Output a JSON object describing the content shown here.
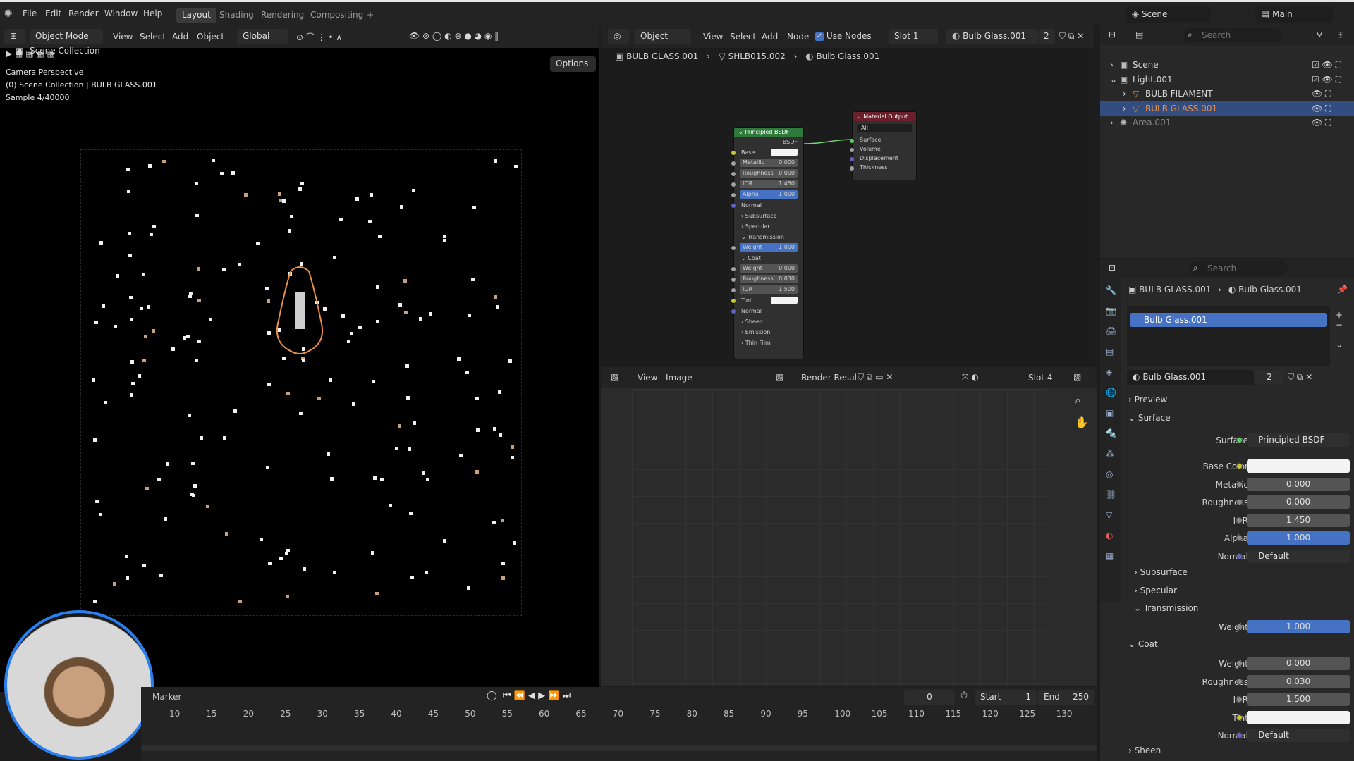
{
  "topbar": {
    "menus": [
      "File",
      "Edit",
      "Render",
      "Window",
      "Help"
    ],
    "workspace_tabs": [
      "Layout",
      "Shading",
      "Rendering",
      "Compositing"
    ],
    "active_tab": "Layout",
    "plus": "+",
    "scene_label": "Scene",
    "view_layer_label": "Main"
  },
  "viewport_header": {
    "mode": "Object Mode",
    "menus": [
      "View",
      "Select",
      "Add",
      "Object"
    ],
    "transform": "Global",
    "options": "Options"
  },
  "viewport_overlay": {
    "line1": "Camera Perspective",
    "line2": "(0) Scene Collection | BULB GLASS.001",
    "line3": "Sample 4/40000"
  },
  "node_header": {
    "object_type": "Object",
    "menus": [
      "View",
      "Select",
      "Add",
      "Node"
    ],
    "use_nodes": "Use Nodes",
    "slot": "Slot 1",
    "material": "Bulb Glass.001",
    "users": "2",
    "breadcrumb": [
      "BULB GLASS.001",
      "SHLB015.002",
      "Bulb Glass.001"
    ]
  },
  "principled_node": {
    "title": "Principled BSDF",
    "output": "BSDF",
    "rows": [
      {
        "label": "Base ...",
        "value": "",
        "kind": "white"
      },
      {
        "label": "Metallic",
        "value": "0.000",
        "kind": "field"
      },
      {
        "label": "Roughness",
        "value": "0.000",
        "kind": "field"
      },
      {
        "label": "IOR",
        "value": "1.450",
        "kind": "field"
      },
      {
        "label": "Alpha",
        "value": "1.000",
        "kind": "blue"
      },
      {
        "label": "Normal",
        "value": "",
        "kind": "label"
      },
      {
        "label": "Subsurface",
        "value": "",
        "kind": "section"
      },
      {
        "label": "Specular",
        "value": "",
        "kind": "section"
      },
      {
        "label": "Transmission",
        "value": "",
        "kind": "section-open"
      },
      {
        "label": "Weight",
        "value": "1.000",
        "kind": "blue"
      },
      {
        "label": "Coat",
        "value": "",
        "kind": "section-open"
      },
      {
        "label": "Weight",
        "value": "0.000",
        "kind": "field"
      },
      {
        "label": "Roughness",
        "value": "0.030",
        "kind": "field"
      },
      {
        "label": "IOR",
        "value": "1.500",
        "kind": "field"
      },
      {
        "label": "Tint",
        "value": "",
        "kind": "white"
      },
      {
        "label": "Normal",
        "value": "",
        "kind": "label"
      },
      {
        "label": "Sheen",
        "value": "",
        "kind": "section"
      },
      {
        "label": "Emission",
        "value": "",
        "kind": "section"
      },
      {
        "label": "Thin Film",
        "value": "",
        "kind": "section"
      }
    ]
  },
  "output_node": {
    "title": "Material Output",
    "target": "All",
    "sockets": [
      "Surface",
      "Volume",
      "Displacement",
      "Thickness"
    ]
  },
  "image_editor": {
    "menus": [
      "View",
      "Image"
    ],
    "image": "Render Result",
    "slot": "Slot 4"
  },
  "timeline": {
    "marker": "Marker",
    "current_frame": "0",
    "start_label": "Start",
    "start": "1",
    "end_label": "End",
    "end": "250",
    "ticks": [
      "10",
      "15",
      "20",
      "25",
      "30",
      "35",
      "40",
      "45",
      "50",
      "55",
      "60",
      "65",
      "70",
      "75",
      "80",
      "85",
      "90",
      "95",
      "100",
      "105",
      "110",
      "115",
      "120",
      "125",
      "130"
    ]
  },
  "outliner": {
    "search_placeholder": "Search",
    "root": "Scene Collection",
    "items": [
      {
        "label": "Scene",
        "indent": 1
      },
      {
        "label": "Light.001",
        "indent": 1
      },
      {
        "label": "BULB FILAMENT",
        "indent": 2
      },
      {
        "label": "BULB GLASS.001",
        "indent": 2
      },
      {
        "label": "Area.001",
        "indent": 1
      }
    ]
  },
  "properties": {
    "search_placeholder": "Search",
    "breadcrumb_object": "BULB GLASS.001",
    "breadcrumb_material": "Bulb Glass.001",
    "slot_item": "Bulb Glass.001",
    "material_name": "Bulb Glass.001",
    "material_users": "2",
    "preview": "Preview",
    "surface_section": "Surface",
    "surface_label": "Surface",
    "surface_value": "Principled BSDF",
    "rows": [
      {
        "label": "Base Color",
        "value": "",
        "kind": "white"
      },
      {
        "label": "Metallic",
        "value": "0.000",
        "kind": "field"
      },
      {
        "label": "Roughness",
        "value": "0.000",
        "kind": "field"
      },
      {
        "label": "IOR",
        "value": "1.450",
        "kind": "field"
      },
      {
        "label": "Alpha",
        "value": "1.000",
        "kind": "blue"
      },
      {
        "label": "Normal",
        "value": "Default",
        "kind": "dark"
      }
    ],
    "subsections": [
      "Subsurface",
      "Specular",
      "Transmission"
    ],
    "transmission_weight_label": "Weight",
    "transmission_weight": "1.000",
    "coat_section": "Coat",
    "coat_rows": [
      {
        "label": "Weight",
        "value": "0.000",
        "kind": "field"
      },
      {
        "label": "Roughness",
        "value": "0.030",
        "kind": "field"
      },
      {
        "label": "IOR",
        "value": "1.500",
        "kind": "field"
      },
      {
        "label": "Tint",
        "value": "",
        "kind": "white"
      },
      {
        "label": "Normal",
        "value": "Default",
        "kind": "dark"
      }
    ],
    "sheen": "Sheen"
  },
  "colors": {
    "accent_blue": "#4672c4",
    "selection": "#334d80",
    "node_header_green": "#2f7a3a",
    "output_header_red": "#6a1f2a",
    "bulb_outline": "#e8904a"
  }
}
